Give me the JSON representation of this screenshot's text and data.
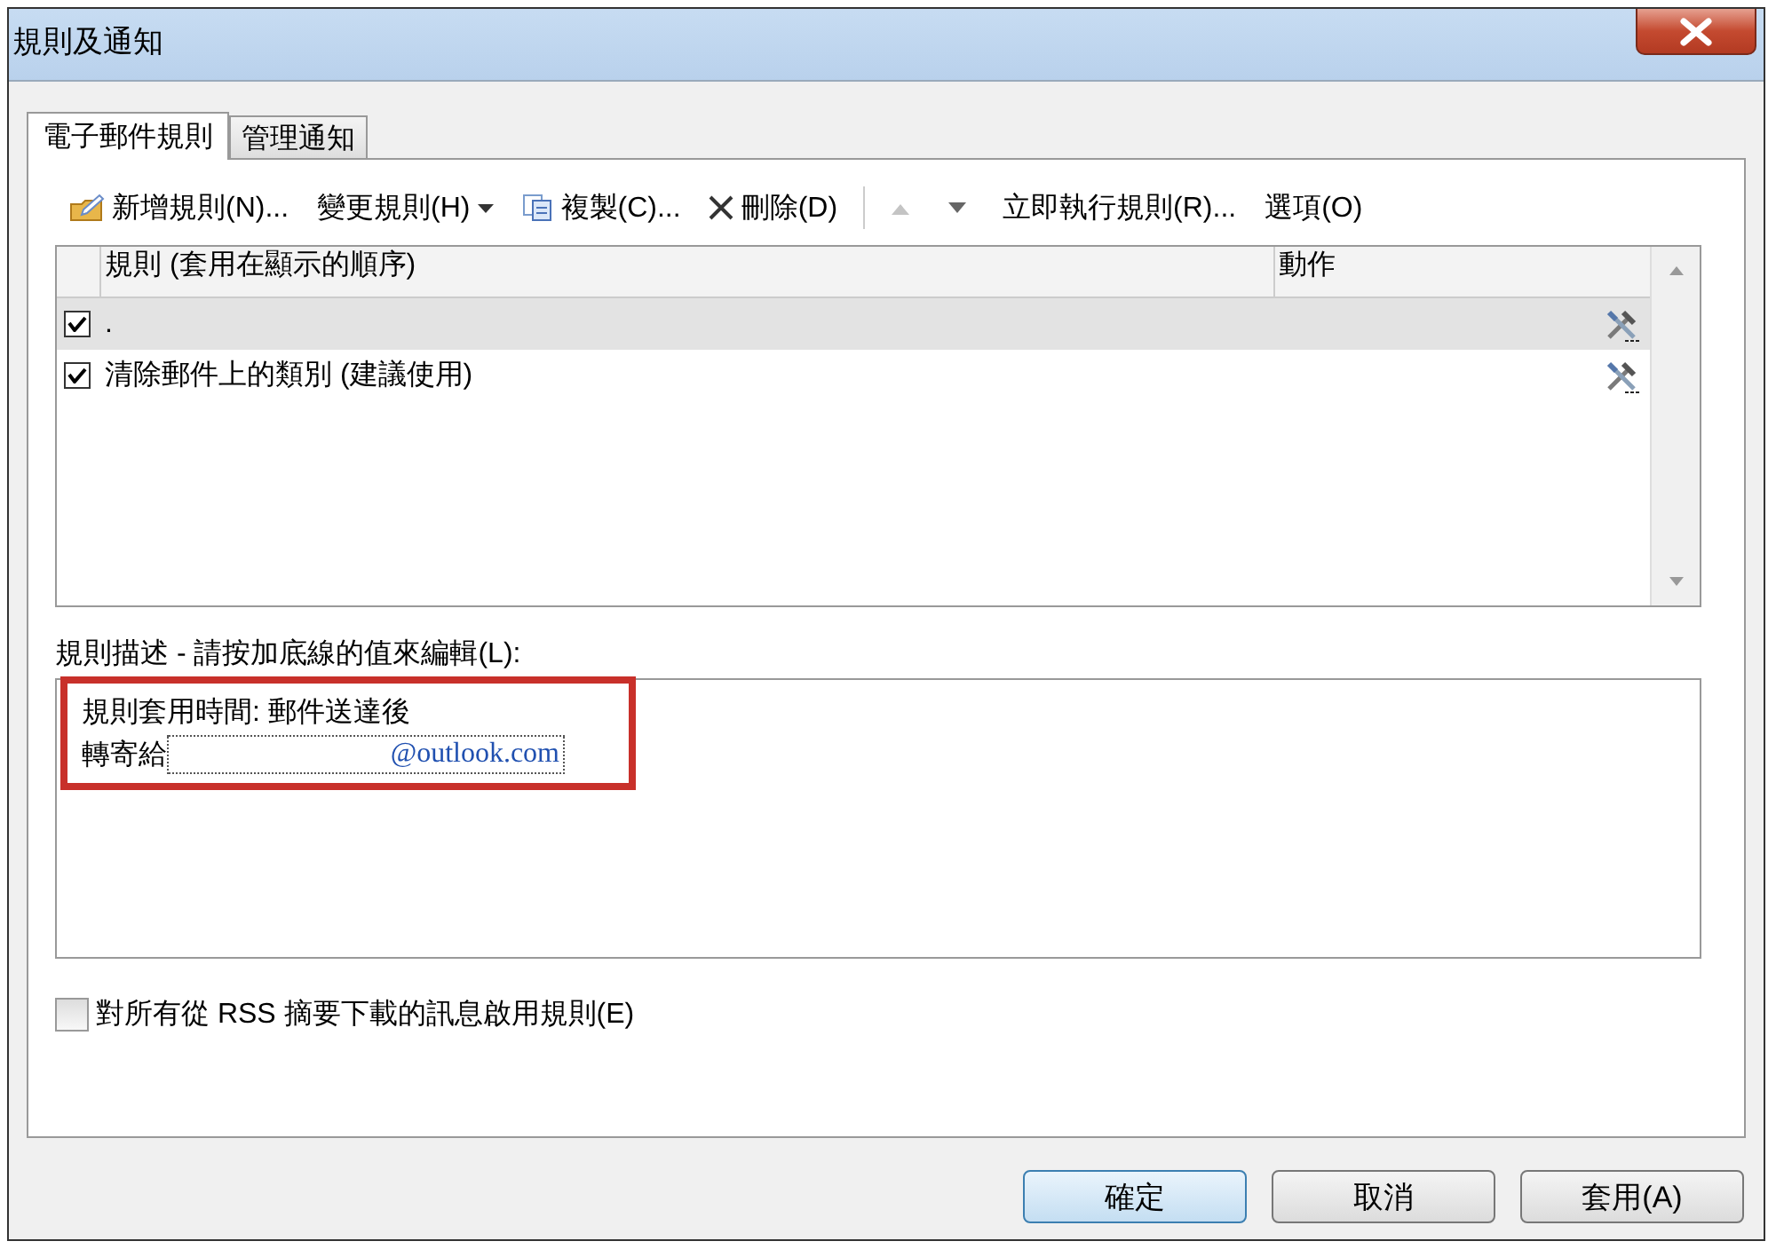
{
  "window": {
    "title": "規則及通知"
  },
  "tabs": [
    {
      "label": "電子郵件規則",
      "selected": true
    },
    {
      "label": "管理通知",
      "selected": false
    }
  ],
  "toolbar": [
    {
      "kind": "new",
      "label": "新增規則(N)..."
    },
    {
      "kind": "menu",
      "label": "變更規則(H)"
    },
    {
      "kind": "copy",
      "label": "複製(C)..."
    },
    {
      "kind": "delete",
      "label": "刪除(D)"
    },
    {
      "kind": "separator"
    },
    {
      "kind": "up",
      "disabled": true
    },
    {
      "kind": "down",
      "disabled": false
    },
    {
      "kind": "plain",
      "label": "立即執行規則(R)..."
    },
    {
      "kind": "plain",
      "label": "選項(O)"
    }
  ],
  "rules_list": {
    "columns": [
      "規則 (套用在顯示的順序)",
      "動作"
    ],
    "rows": [
      {
        "name": ".",
        "checked": true,
        "selected": true
      },
      {
        "name": "清除郵件上的類別 (建議使用)",
        "checked": true,
        "selected": false
      }
    ]
  },
  "description": {
    "label": "規則描述 - 請按加底線的值來編輯(L):",
    "highlighted": true,
    "lines": [
      {
        "text": "規則套用時間: 郵件送達後"
      },
      {
        "text": "轉寄給",
        "link": "@outlook.com"
      }
    ]
  },
  "rss_option": {
    "label": "對所有從 RSS 摘要下載的訊息啟用規則(E)",
    "checked": false
  },
  "buttons": [
    {
      "label": "確定",
      "default": true
    },
    {
      "label": "取消",
      "default": false
    },
    {
      "label": "套用(A)",
      "default": false
    }
  ]
}
